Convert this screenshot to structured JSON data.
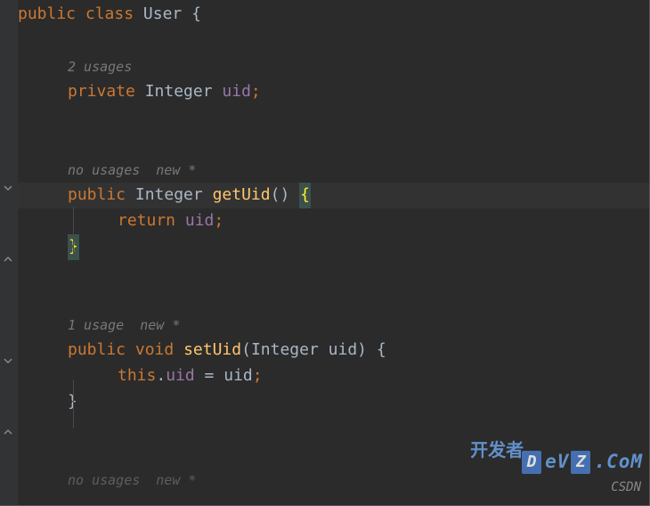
{
  "classDecl": {
    "keywords": [
      "public",
      "class"
    ],
    "name": "User",
    "openBrace": "{"
  },
  "field1": {
    "usageHint": "2 usages",
    "keywords": [
      "private"
    ],
    "type": "Integer",
    "name": "uid",
    "semi": ";"
  },
  "method1": {
    "usageHint": "no usages",
    "newHint": "new *",
    "keywords": [
      "public"
    ],
    "returnType": "Integer",
    "name": "getUid",
    "parens": "()",
    "openBrace": "{",
    "returnKw": "return",
    "returnVal": "uid",
    "semi": ";",
    "closeBrace": "}"
  },
  "method2": {
    "usageHint": "1 usage",
    "newHint": "new *",
    "keywords": [
      "public"
    ],
    "returnType": "void",
    "name": "setUid",
    "paramOpen": "(",
    "paramType": "Integer",
    "paramName": "uid",
    "paramClose": ")",
    "openBrace": "{",
    "thisKw": "this",
    "dot": ".",
    "field": "uid",
    "eq": " = ",
    "rhs": "uid",
    "semi": ";",
    "closeBrace": "}"
  },
  "method3": {
    "usageHint": "no usages",
    "newHint": "new *"
  },
  "watermark": {
    "brand": "开发者",
    "boxes": [
      "D",
      "Z"
    ],
    "suffix": "eV",
    "suffix2": ".CoM",
    "bottom": "CSDN"
  }
}
